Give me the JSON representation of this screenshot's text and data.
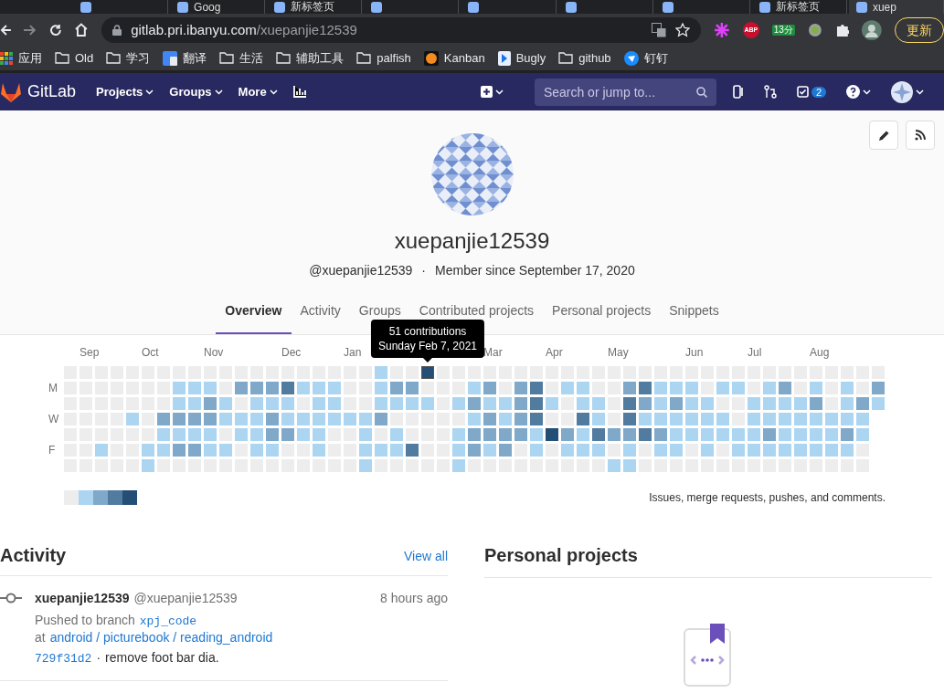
{
  "browser": {
    "tabs": [
      {
        "selected": false
      },
      {
        "title": "Goog",
        "selected": false
      },
      {
        "title": "新标签页",
        "selected": false
      },
      {
        "selected": false
      },
      {
        "selected": false
      },
      {
        "selected": false
      },
      {
        "selected": false
      },
      {
        "title": "新标签页",
        "selected": false
      },
      {
        "title": "xuep",
        "selected": true
      }
    ],
    "address": {
      "host": "gitlab.pri.ibanyu.com",
      "path": "/xuepanjie12539"
    },
    "extensions": {
      "abp": "ABP",
      "timer_badge": "13分",
      "update_button": "更新"
    },
    "bookmarks": [
      {
        "kind": "apps",
        "label": "应用"
      },
      {
        "kind": "folder",
        "label": "Old"
      },
      {
        "kind": "folder",
        "label": "学习"
      },
      {
        "kind": "translate",
        "label": "翻译"
      },
      {
        "kind": "folder",
        "label": "生活"
      },
      {
        "kind": "folder",
        "label": "辅助工具"
      },
      {
        "kind": "folder",
        "label": "palfish"
      },
      {
        "kind": "kanban",
        "label": "Kanban"
      },
      {
        "kind": "bugly",
        "label": "Bugly"
      },
      {
        "kind": "folder",
        "label": "github"
      },
      {
        "kind": "dingtalk",
        "label": "钉钉"
      }
    ]
  },
  "navbar": {
    "brand": "GitLab",
    "menus": [
      "Projects",
      "Groups",
      "More"
    ],
    "search": {
      "placeholder": "Search or jump to..."
    },
    "todo_count": "2"
  },
  "profile": {
    "name": "xuepanjie12539",
    "handle": "@xuepanjie12539",
    "separator": "·",
    "member_since": "Member since September 17, 2020"
  },
  "tabs": [
    {
      "label": "Overview",
      "selected": true
    },
    {
      "label": "Activity",
      "selected": false
    },
    {
      "label": "Groups",
      "selected": false
    },
    {
      "label": "Contributed projects",
      "selected": false
    },
    {
      "label": "Personal projects",
      "selected": false
    },
    {
      "label": "Snippets",
      "selected": false
    }
  ],
  "graph": {
    "months": [
      "Sep",
      "Oct",
      "Nov",
      "Dec",
      "Jan",
      "Mar",
      "Apr",
      "May",
      "Jun",
      "Jul",
      "Aug"
    ],
    "day_labels": [
      "M",
      "W",
      "F"
    ],
    "rows": [
      {
        "cells": [
          {
            "color": "#ededed"
          },
          {
            "color": "#ededed"
          },
          {
            "color": "#ededed"
          },
          {
            "color": "#ededed"
          },
          {
            "color": "#ededed"
          },
          {
            "color": "#ededed"
          },
          {
            "color": "#ededed"
          },
          {
            "color": "#ededed"
          },
          {
            "color": "#ededed"
          },
          {
            "color": "#ededed"
          },
          {
            "color": "#ededed"
          },
          {
            "color": "#ededed"
          },
          {
            "color": "#ededed"
          },
          {
            "color": "#ededed"
          },
          {
            "color": "#ededed"
          },
          {
            "color": "#ededed"
          },
          {
            "color": "#ededed"
          },
          {
            "color": "#ededed"
          },
          {
            "color": "#ededed"
          },
          {
            "color": "#ededed"
          },
          {
            "color": "#acd5f2"
          },
          {
            "color": "#ededed"
          },
          {
            "color": "#ededed"
          },
          {
            "color": "#254e77",
            "tooltip": {
              "count": "51 contributions",
              "date": "Sunday Feb 7, 2021"
            }
          },
          {
            "color": "#ededed"
          },
          {
            "color": "#ededed"
          },
          {
            "color": "#ededed"
          },
          {
            "color": "#ededed"
          },
          {
            "color": "#ededed"
          },
          {
            "color": "#ededed"
          },
          {
            "color": "#ededed"
          },
          {
            "color": "#ededed"
          },
          {
            "color": "#ededed"
          },
          {
            "color": "#ededed"
          },
          {
            "color": "#ededed"
          },
          {
            "color": "#ededed"
          },
          {
            "color": "#ededed"
          },
          {
            "color": "#ededed"
          },
          {
            "color": "#ededed"
          },
          {
            "color": "#ededed"
          },
          {
            "color": "#ededed"
          },
          {
            "color": "#ededed"
          },
          {
            "color": "#ededed"
          },
          {
            "color": "#ededed"
          },
          {
            "color": "#ededed"
          },
          {
            "color": "#ededed"
          },
          {
            "color": "#ededed"
          },
          {
            "color": "#ededed"
          },
          {
            "color": "#ededed"
          },
          {
            "color": "#ededed"
          },
          {
            "color": "#ededed"
          },
          {
            "color": "#ededed"
          },
          {
            "color": "#ededed"
          }
        ]
      },
      {
        "cells": [
          {
            "color": "#ededed"
          },
          {
            "color": "#ededed"
          },
          {
            "color": "#ededed"
          },
          {
            "color": "#ededed"
          },
          {
            "color": "#ededed"
          },
          {
            "color": "#ededed"
          },
          {
            "color": "#ededed"
          },
          {
            "color": "#acd5f2"
          },
          {
            "color": "#acd5f2"
          },
          {
            "color": "#acd5f2"
          },
          {
            "color": "#ededed"
          },
          {
            "color": "#7fa8c9"
          },
          {
            "color": "#7fa8c9"
          },
          {
            "color": "#7fa8c9"
          },
          {
            "color": "#527ba0"
          },
          {
            "color": "#acd5f2"
          },
          {
            "color": "#acd5f2"
          },
          {
            "color": "#acd5f2"
          },
          {
            "color": "#ededed"
          },
          {
            "color": "#ededed"
          },
          {
            "color": "#acd5f2"
          },
          {
            "color": "#7fa8c9"
          },
          {
            "color": "#7fa8c9"
          },
          {
            "color": "#ededed"
          },
          {
            "color": "#ededed"
          },
          {
            "color": "#ededed"
          },
          {
            "color": "#acd5f2"
          },
          {
            "color": "#7fa8c9"
          },
          {
            "color": "#ededed"
          },
          {
            "color": "#7fa8c9"
          },
          {
            "color": "#527ba0"
          },
          {
            "color": "#ededed"
          },
          {
            "color": "#acd5f2"
          },
          {
            "color": "#acd5f2"
          },
          {
            "color": "#ededed"
          },
          {
            "color": "#ededed"
          },
          {
            "color": "#7fa8c9"
          },
          {
            "color": "#527ba0"
          },
          {
            "color": "#acd5f2"
          },
          {
            "color": "#acd5f2"
          },
          {
            "color": "#acd5f2"
          },
          {
            "color": "#ededed"
          },
          {
            "color": "#acd5f2"
          },
          {
            "color": "#acd5f2"
          },
          {
            "color": "#ededed"
          },
          {
            "color": "#acd5f2"
          },
          {
            "color": "#7fa8c9"
          },
          {
            "color": "#ededed"
          },
          {
            "color": "#acd5f2"
          },
          {
            "color": "#ededed"
          },
          {
            "color": "#acd5f2"
          },
          {
            "color": "#ededed"
          },
          {
            "color": "#7fa8c9"
          }
        ]
      },
      {
        "cells": [
          {
            "color": "#ededed"
          },
          {
            "color": "#ededed"
          },
          {
            "color": "#ededed"
          },
          {
            "color": "#ededed"
          },
          {
            "color": "#ededed"
          },
          {
            "color": "#ededed"
          },
          {
            "color": "#ededed"
          },
          {
            "color": "#acd5f2"
          },
          {
            "color": "#acd5f2"
          },
          {
            "color": "#7fa8c9"
          },
          {
            "color": "#acd5f2"
          },
          {
            "color": "#ededed"
          },
          {
            "color": "#acd5f2"
          },
          {
            "color": "#acd5f2"
          },
          {
            "color": "#acd5f2"
          },
          {
            "color": "#ededed"
          },
          {
            "color": "#acd5f2"
          },
          {
            "color": "#acd5f2"
          },
          {
            "color": "#ededed"
          },
          {
            "color": "#ededed"
          },
          {
            "color": "#acd5f2"
          },
          {
            "color": "#acd5f2"
          },
          {
            "color": "#acd5f2"
          },
          {
            "color": "#acd5f2"
          },
          {
            "color": "#ededed"
          },
          {
            "color": "#acd5f2"
          },
          {
            "color": "#7fa8c9"
          },
          {
            "color": "#acd5f2"
          },
          {
            "color": "#acd5f2"
          },
          {
            "color": "#7fa8c9"
          },
          {
            "color": "#527ba0"
          },
          {
            "color": "#acd5f2"
          },
          {
            "color": "#ededed"
          },
          {
            "color": "#acd5f2"
          },
          {
            "color": "#acd5f2"
          },
          {
            "color": "#ededed"
          },
          {
            "color": "#527ba0"
          },
          {
            "color": "#7fa8c9"
          },
          {
            "color": "#acd5f2"
          },
          {
            "color": "#7fa8c9"
          },
          {
            "color": "#acd5f2"
          },
          {
            "color": "#acd5f2"
          },
          {
            "color": "#ededed"
          },
          {
            "color": "#ededed"
          },
          {
            "color": "#acd5f2"
          },
          {
            "color": "#acd5f2"
          },
          {
            "color": "#acd5f2"
          },
          {
            "color": "#acd5f2"
          },
          {
            "color": "#7fa8c9"
          },
          {
            "color": "#ededed"
          },
          {
            "color": "#acd5f2"
          },
          {
            "color": "#7fa8c9"
          },
          {
            "color": "#acd5f2"
          }
        ]
      },
      {
        "cells": [
          {
            "color": "#ededed"
          },
          {
            "color": "#ededed"
          },
          {
            "color": "#ededed"
          },
          {
            "color": "#ededed"
          },
          {
            "color": "#acd5f2"
          },
          {
            "color": "#ededed"
          },
          {
            "color": "#7fa8c9"
          },
          {
            "color": "#7fa8c9"
          },
          {
            "color": "#7fa8c9"
          },
          {
            "color": "#7fa8c9"
          },
          {
            "color": "#acd5f2"
          },
          {
            "color": "#acd5f2"
          },
          {
            "color": "#acd5f2"
          },
          {
            "color": "#7fa8c9"
          },
          {
            "color": "#acd5f2"
          },
          {
            "color": "#acd5f2"
          },
          {
            "color": "#acd5f2"
          },
          {
            "color": "#acd5f2"
          },
          {
            "color": "#acd5f2"
          },
          {
            "color": "#acd5f2"
          },
          {
            "color": "#7fa8c9"
          },
          {
            "color": "#ededed"
          },
          {
            "color": "#ededed"
          },
          {
            "color": "#ededed"
          },
          {
            "color": "#ededed"
          },
          {
            "color": "#ededed"
          },
          {
            "color": "#acd5f2"
          },
          {
            "color": "#7fa8c9"
          },
          {
            "color": "#acd5f2"
          },
          {
            "color": "#7fa8c9"
          },
          {
            "color": "#527ba0"
          },
          {
            "color": "#ededed"
          },
          {
            "color": "#ededed"
          },
          {
            "color": "#527ba0"
          },
          {
            "color": "#acd5f2"
          },
          {
            "color": "#ededed"
          },
          {
            "color": "#527ba0"
          },
          {
            "color": "#acd5f2"
          },
          {
            "color": "#acd5f2"
          },
          {
            "color": "#acd5f2"
          },
          {
            "color": "#acd5f2"
          },
          {
            "color": "#acd5f2"
          },
          {
            "color": "#acd5f2"
          },
          {
            "color": "#ededed"
          },
          {
            "color": "#acd5f2"
          },
          {
            "color": "#acd5f2"
          },
          {
            "color": "#acd5f2"
          },
          {
            "color": "#acd5f2"
          },
          {
            "color": "#acd5f2"
          },
          {
            "color": "#acd5f2"
          },
          {
            "color": "#acd5f2"
          },
          {
            "color": "#acd5f2"
          }
        ]
      },
      {
        "cells": [
          {
            "color": "#ededed"
          },
          {
            "color": "#ededed"
          },
          {
            "color": "#ededed"
          },
          {
            "color": "#ededed"
          },
          {
            "color": "#ededed"
          },
          {
            "color": "#ededed"
          },
          {
            "color": "#acd5f2"
          },
          {
            "color": "#acd5f2"
          },
          {
            "color": "#acd5f2"
          },
          {
            "color": "#acd5f2"
          },
          {
            "color": "#ededed"
          },
          {
            "color": "#acd5f2"
          },
          {
            "color": "#acd5f2"
          },
          {
            "color": "#7fa8c9"
          },
          {
            "color": "#7fa8c9"
          },
          {
            "color": "#acd5f2"
          },
          {
            "color": "#acd5f2"
          },
          {
            "color": "#ededed"
          },
          {
            "color": "#ededed"
          },
          {
            "color": "#acd5f2"
          },
          {
            "color": "#ededed"
          },
          {
            "color": "#acd5f2"
          },
          {
            "color": "#ededed"
          },
          {
            "color": "#ededed"
          },
          {
            "color": "#ededed"
          },
          {
            "color": "#acd5f2"
          },
          {
            "color": "#7fa8c9"
          },
          {
            "color": "#7fa8c9"
          },
          {
            "color": "#7fa8c9"
          },
          {
            "color": "#7fa8c9"
          },
          {
            "color": "#acd5f2"
          },
          {
            "color": "#254e77"
          },
          {
            "color": "#7fa8c9"
          },
          {
            "color": "#acd5f2"
          },
          {
            "color": "#527ba0"
          },
          {
            "color": "#7fa8c9"
          },
          {
            "color": "#7fa8c9"
          },
          {
            "color": "#527ba0"
          },
          {
            "color": "#7fa8c9"
          },
          {
            "color": "#acd5f2"
          },
          {
            "color": "#acd5f2"
          },
          {
            "color": "#acd5f2"
          },
          {
            "color": "#acd5f2"
          },
          {
            "color": "#acd5f2"
          },
          {
            "color": "#acd5f2"
          },
          {
            "color": "#7fa8c9"
          },
          {
            "color": "#acd5f2"
          },
          {
            "color": "#acd5f2"
          },
          {
            "color": "#acd5f2"
          },
          {
            "color": "#acd5f2"
          },
          {
            "color": "#7fa8c9"
          },
          {
            "color": "#acd5f2"
          }
        ]
      },
      {
        "cells": [
          {
            "color": "#ededed"
          },
          {
            "color": "#ededed"
          },
          {
            "color": "#acd5f2"
          },
          {
            "color": "#ededed"
          },
          {
            "color": "#ededed"
          },
          {
            "color": "#acd5f2"
          },
          {
            "color": "#acd5f2"
          },
          {
            "color": "#7fa8c9"
          },
          {
            "color": "#7fa8c9"
          },
          {
            "color": "#acd5f2"
          },
          {
            "color": "#acd5f2"
          },
          {
            "color": "#ededed"
          },
          {
            "color": "#acd5f2"
          },
          {
            "color": "#acd5f2"
          },
          {
            "color": "#ededed"
          },
          {
            "color": "#ededed"
          },
          {
            "color": "#acd5f2"
          },
          {
            "color": "#ededed"
          },
          {
            "color": "#ededed"
          },
          {
            "color": "#acd5f2"
          },
          {
            "color": "#acd5f2"
          },
          {
            "color": "#acd5f2"
          },
          {
            "color": "#527ba0"
          },
          {
            "color": "#ededed"
          },
          {
            "color": "#ededed"
          },
          {
            "color": "#acd5f2"
          },
          {
            "color": "#7fa8c9"
          },
          {
            "color": "#acd5f2"
          },
          {
            "color": "#7fa8c9"
          },
          {
            "color": "#ededed"
          },
          {
            "color": "#acd5f2"
          },
          {
            "color": "#ededed"
          },
          {
            "color": "#acd5f2"
          },
          {
            "color": "#acd5f2"
          },
          {
            "color": "#acd5f2"
          },
          {
            "color": "#ededed"
          },
          {
            "color": "#acd5f2"
          },
          {
            "color": "#ededed"
          },
          {
            "color": "#acd5f2"
          },
          {
            "color": "#acd5f2"
          },
          {
            "color": "#ededed"
          },
          {
            "color": "#acd5f2"
          },
          {
            "color": "#ededed"
          },
          {
            "color": "#acd5f2"
          },
          {
            "color": "#acd5f2"
          },
          {
            "color": "#acd5f2"
          },
          {
            "color": "#acd5f2"
          },
          {
            "color": "#acd5f2"
          },
          {
            "color": "#acd5f2"
          },
          {
            "color": "#acd5f2"
          },
          {
            "color": "#acd5f2"
          },
          {
            "color": "#ededed"
          }
        ]
      },
      {
        "cells": [
          {
            "color": "#ededed"
          },
          {
            "color": "#ededed"
          },
          {
            "color": "#ededed"
          },
          {
            "color": "#ededed"
          },
          {
            "color": "#ededed"
          },
          {
            "color": "#acd5f2"
          },
          {
            "color": "#ededed"
          },
          {
            "color": "#ededed"
          },
          {
            "color": "#ededed"
          },
          {
            "color": "#ededed"
          },
          {
            "color": "#ededed"
          },
          {
            "color": "#ededed"
          },
          {
            "color": "#ededed"
          },
          {
            "color": "#ededed"
          },
          {
            "color": "#ededed"
          },
          {
            "color": "#ededed"
          },
          {
            "color": "#ededed"
          },
          {
            "color": "#ededed"
          },
          {
            "color": "#ededed"
          },
          {
            "color": "#acd5f2"
          },
          {
            "color": "#ededed"
          },
          {
            "color": "#ededed"
          },
          {
            "color": "#ededed"
          },
          {
            "color": "#ededed"
          },
          {
            "color": "#ededed"
          },
          {
            "color": "#acd5f2"
          },
          {
            "color": "#ededed"
          },
          {
            "color": "#ededed"
          },
          {
            "color": "#ededed"
          },
          {
            "color": "#ededed"
          },
          {
            "color": "#ededed"
          },
          {
            "color": "#ededed"
          },
          {
            "color": "#ededed"
          },
          {
            "color": "#ededed"
          },
          {
            "color": "#ededed"
          },
          {
            "color": "#acd5f2"
          },
          {
            "color": "#acd5f2"
          },
          {
            "color": "#ededed"
          },
          {
            "color": "#ededed"
          },
          {
            "color": "#ededed"
          },
          {
            "color": "#ededed"
          },
          {
            "color": "#ededed"
          },
          {
            "color": "#ededed"
          },
          {
            "color": "#ededed"
          },
          {
            "color": "#ededed"
          },
          {
            "color": "#ededed"
          },
          {
            "color": "#ededed"
          },
          {
            "color": "#ededed"
          },
          {
            "color": "#ededed"
          },
          {
            "color": "#ededed"
          },
          {
            "color": "#ededed"
          },
          {
            "color": "#ededed"
          }
        ]
      }
    ],
    "legend": [
      {
        "color": "#ededed"
      },
      {
        "color": "#acd5f2"
      },
      {
        "color": "#7fa8c9"
      },
      {
        "color": "#527ba0"
      },
      {
        "color": "#254e77"
      }
    ],
    "legend_text": "Issues, merge requests, pushes, and comments."
  },
  "activity": {
    "title": "Activity",
    "view_all": "View all",
    "events": [
      {
        "author": "xuepanjie12539",
        "handle": "@xuepanjie12539",
        "time": "8 hours ago",
        "action": "Pushed to branch",
        "branch": "xpj_code",
        "at": "at",
        "project": "android / picturebook / reading_android",
        "commit": "729f31d2",
        "separator": "·",
        "message": "remove foot bar dia."
      }
    ]
  },
  "personal_projects": {
    "title": "Personal projects"
  }
}
